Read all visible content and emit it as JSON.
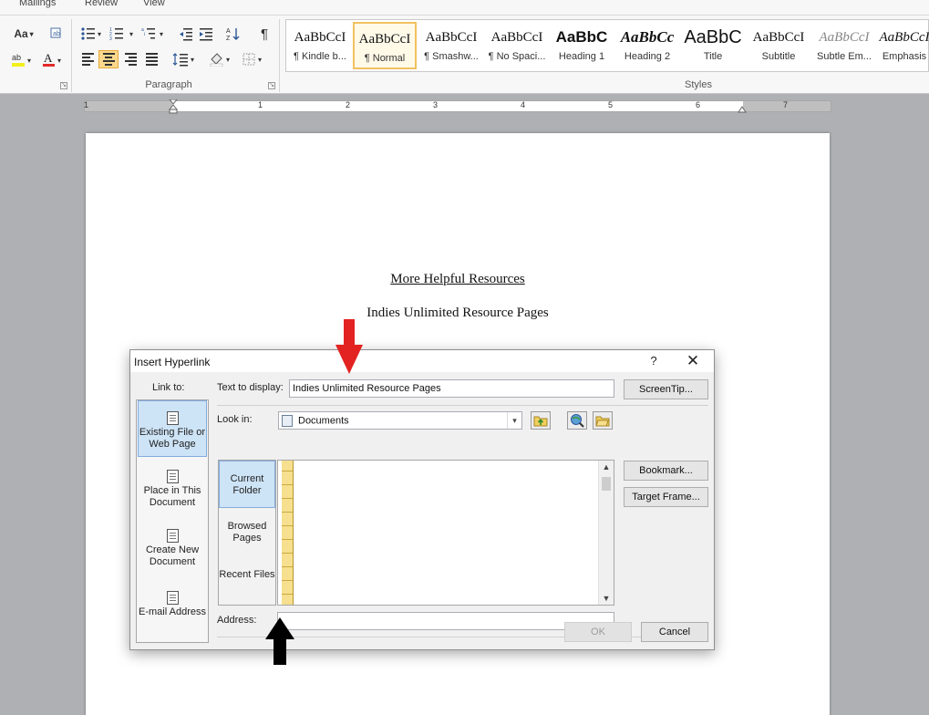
{
  "ribbon": {
    "tabs": [
      "Mailings",
      "Review",
      "View"
    ],
    "groups": {
      "paragraph": "Paragraph",
      "styles": "Styles"
    },
    "font_size_label": "Aa",
    "styles": [
      {
        "sample": "AaBbCcI",
        "name": "¶ Kindle b..."
      },
      {
        "sample": "AaBbCcI",
        "name": "¶ Normal"
      },
      {
        "sample": "AaBbCcI",
        "name": "¶ Smashw..."
      },
      {
        "sample": "AaBbCcI",
        "name": "¶ No Spaci..."
      },
      {
        "sample": "AaBbC",
        "name": "Heading 1"
      },
      {
        "sample": "AaBbCc",
        "name": "Heading 2"
      },
      {
        "sample": "AaBbC",
        "name": "Title"
      },
      {
        "sample": "AaBbCcI",
        "name": "Subtitle"
      },
      {
        "sample": "AaBbCcI",
        "name": "Subtle Em..."
      },
      {
        "sample": "AaBbCcI",
        "name": "Emphasis"
      }
    ]
  },
  "ruler": {
    "numbers": [
      "1",
      "1",
      "2",
      "3",
      "4",
      "5",
      "6",
      "7"
    ]
  },
  "document": {
    "line1": "More Helpful Resources",
    "line2": "Indies Unlimited Resource Pages"
  },
  "dialog": {
    "title": "Insert Hyperlink",
    "help": "?",
    "close": "✕",
    "link_to_label": "Link to:",
    "link_to": [
      {
        "label": "Existing File or Web Page",
        "selected": true
      },
      {
        "label": "Place in This Document",
        "selected": false
      },
      {
        "label": "Create New Document",
        "selected": false
      },
      {
        "label": "E-mail Address",
        "selected": false
      }
    ],
    "text_to_display_label": "Text to display:",
    "text_to_display_value": "Indies Unlimited Resource Pages",
    "screentip_button": "ScreenTip...",
    "look_in_label": "Look in:",
    "look_in_value": "Documents",
    "places": [
      {
        "label": "Current Folder",
        "selected": true
      },
      {
        "label": "Browsed Pages",
        "selected": false
      },
      {
        "label": "Recent Files",
        "selected": false
      }
    ],
    "bookmark_button": "Bookmark...",
    "target_frame_button": "Target Frame...",
    "address_label": "Address:",
    "address_value": "",
    "ok_button": "OK",
    "cancel_button": "Cancel"
  },
  "colors": {
    "accent_selected": "#cde3f6",
    "annotation_red": "#e32222",
    "annotation_black": "#000000"
  }
}
